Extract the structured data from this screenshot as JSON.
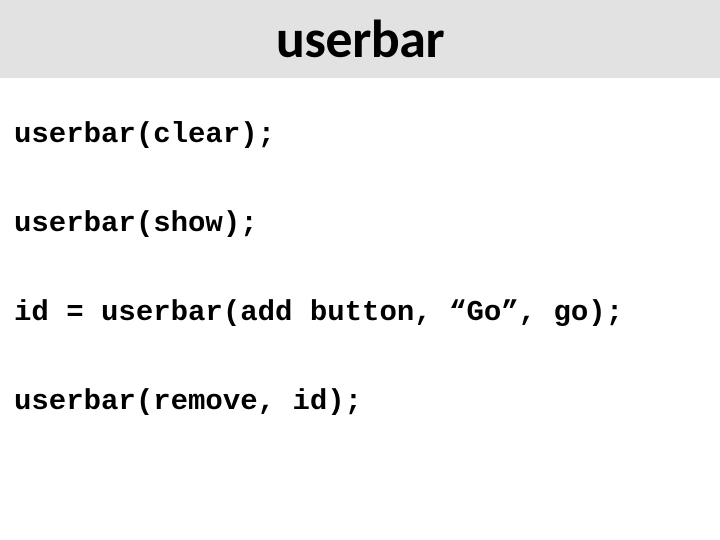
{
  "slide": {
    "title": "userbar",
    "lines": [
      "userbar(clear);",
      "userbar(show);",
      "id = userbar(add button, “Go”, go);",
      "userbar(remove, id);"
    ]
  }
}
